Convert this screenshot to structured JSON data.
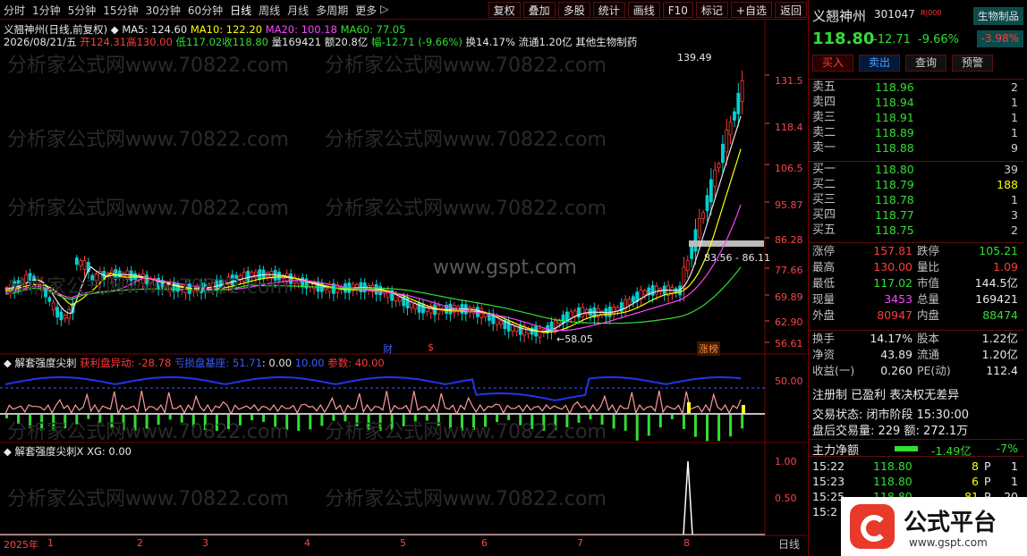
{
  "toolbar": {
    "periods": [
      "分时",
      "1分钟",
      "5分钟",
      "15分钟",
      "30分钟",
      "60分钟",
      "日线",
      "周线",
      "月线",
      "多周期",
      "更多"
    ],
    "more_arrow": "▷",
    "tools": [
      "复权",
      "叠加",
      "多股",
      "统计",
      "画线",
      "F10",
      "标记",
      "+自选",
      "返回"
    ]
  },
  "chart": {
    "title": "义翘神州(日线,前复权)",
    "ma5": "MA5: 124.60",
    "ma10": "MA10: 122.20",
    "ma20": "MA20: 100.18",
    "ma60": "MA60: 77.05",
    "date": "2026/08/21/五",
    "open": "开124.31",
    "high": "高130.00",
    "low": "低117.02",
    "close": "收118.80",
    "volume": "量169421",
    "amount": "额20.8亿",
    "change_pct": "幅-12.71 (-9.66%)",
    "turnover": "换14.17%",
    "float": "流通1.20亿",
    "industry": "其他生物制药",
    "price_axis": [
      "131.5",
      "118.4",
      "106.5",
      "95.87",
      "86.28",
      "77.66",
      "69.89",
      "62.90",
      "56.61"
    ],
    "high_label": "139.49",
    "low_label": "58.05",
    "range_label": "83.56 - 86.11",
    "mark_cai": "财",
    "mark_s": "$",
    "mark_zhangbang": "涨榜",
    "watermark": "www.gspt.com",
    "bg_watermark": "分析家公式网www.70822.com"
  },
  "ind1": {
    "name": "解套强度尖刺",
    "profit": "获利盘异动: -28.78",
    "trap": "亏损盘基座: 51.71",
    "v1": ": 0.00",
    "v2": "10.00",
    "param": "参数: 40.00",
    "axis": "50.00"
  },
  "ind2": {
    "name": "解套强度尖刺X",
    "xg": "XG: 0.00",
    "axis_top": "1.00",
    "axis_mid": "0.50"
  },
  "dates": [
    "2025年",
    "1",
    "2",
    "3",
    "4",
    "5",
    "6",
    "7",
    "8"
  ],
  "period_footer": "日线",
  "panel": {
    "name": "义翘神州",
    "code": "301047",
    "flag": "R|000",
    "sector": "生物制品",
    "price": "118.80",
    "change": "-12.71",
    "pct": "-9.66%",
    "sector_pct": "-3.98%",
    "buttons": {
      "buy": "买入",
      "sell": "卖出",
      "query": "查询",
      "warn": "预警"
    },
    "asks": [
      {
        "label": "卖五",
        "price": "118.96",
        "vol": "2"
      },
      {
        "label": "卖四",
        "price": "118.94",
        "vol": "1"
      },
      {
        "label": "卖三",
        "price": "118.91",
        "vol": "1"
      },
      {
        "label": "卖二",
        "price": "118.89",
        "vol": "1"
      },
      {
        "label": "卖一",
        "price": "118.88",
        "vol": "9"
      }
    ],
    "bids": [
      {
        "label": "买一",
        "price": "118.80",
        "vol": "39"
      },
      {
        "label": "买二",
        "price": "118.79",
        "vol": "188"
      },
      {
        "label": "买三",
        "price": "118.78",
        "vol": "1"
      },
      {
        "label": "买四",
        "price": "118.77",
        "vol": "3"
      },
      {
        "label": "买五",
        "price": "118.75",
        "vol": "2"
      }
    ],
    "stats": [
      {
        "l1": "涨停",
        "v1": "157.81",
        "c1": "#ff3b3b",
        "l2": "跌停",
        "v2": "105.21",
        "c2": "#33dd33"
      },
      {
        "l1": "最高",
        "v1": "130.00",
        "c1": "#ff3b3b",
        "l2": "量比",
        "v2": "1.09",
        "c2": "#ff3b3b"
      },
      {
        "l1": "最低",
        "v1": "117.02",
        "c1": "#33dd33",
        "l2": "市值",
        "v2": "144.5亿",
        "c2": "#e8e8e8"
      },
      {
        "l1": "现量",
        "v1": "3453",
        "c1": "#ff44ff",
        "l2": "总量",
        "v2": "169421",
        "c2": "#e8e8e8"
      },
      {
        "l1": "外盘",
        "v1": "80947",
        "c1": "#ff3b3b",
        "l2": "内盘",
        "v2": "88474",
        "c2": "#33dd33"
      }
    ],
    "fund": [
      {
        "l1": "换手",
        "v1": "14.17%",
        "c1": "#e8e8e8",
        "l2": "股本",
        "v2": "1.22亿",
        "c2": "#e8e8e8"
      },
      {
        "l1": "净资",
        "v1": "43.89",
        "c1": "#e8e8e8",
        "l2": "流通",
        "v2": "1.20亿",
        "c2": "#e8e8e8"
      },
      {
        "l1": "收益(一)",
        "v1": "0.260",
        "c1": "#e8e8e8",
        "l2": "PE(动)",
        "v2": "112.4",
        "c2": "#e8e8e8"
      }
    ],
    "reg": "注册制 已盈利 表决权无差异",
    "status": "交易状态: 闭市阶段 15:30:00",
    "after": "盘后交易量: 229  额: 272.1万",
    "flow_label": "主力净额",
    "flow_val": "-1.49亿",
    "flow_pct": "-7%",
    "ticks": [
      {
        "t": "15:22",
        "p": "118.80",
        "q": "8",
        "s": "P",
        "n": "1"
      },
      {
        "t": "15:23",
        "p": "118.80",
        "q": "6",
        "s": "P",
        "n": "1"
      },
      {
        "t": "15:25",
        "p": "118.80",
        "q": "81",
        "s": "P",
        "n": "20"
      },
      {
        "t": "15:2",
        "p": "",
        "q": "",
        "s": "",
        "n": ""
      }
    ]
  },
  "logo": {
    "text": "公式平台",
    "url": "www.gspt.com"
  }
}
